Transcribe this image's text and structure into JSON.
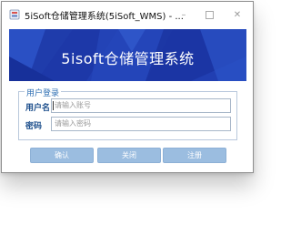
{
  "window": {
    "title": "5iSoft仓储管理系统(5iSoft_WMS) - ...",
    "controls": {
      "minimize": "–",
      "close": "✕"
    }
  },
  "banner": {
    "title": "5isoft仓储管理系统"
  },
  "login": {
    "group_title": "用户登录",
    "username_label": "用户名",
    "username_placeholder": "请输入账号",
    "password_label": "密码",
    "password_placeholder": "请输入密码"
  },
  "buttons": {
    "confirm": "确认",
    "close": "关闭",
    "register": "注册"
  },
  "colors": {
    "banner_blue": "#1f3fb0",
    "button_bg": "#9bbde0",
    "label_blue": "#1d4f8c"
  }
}
